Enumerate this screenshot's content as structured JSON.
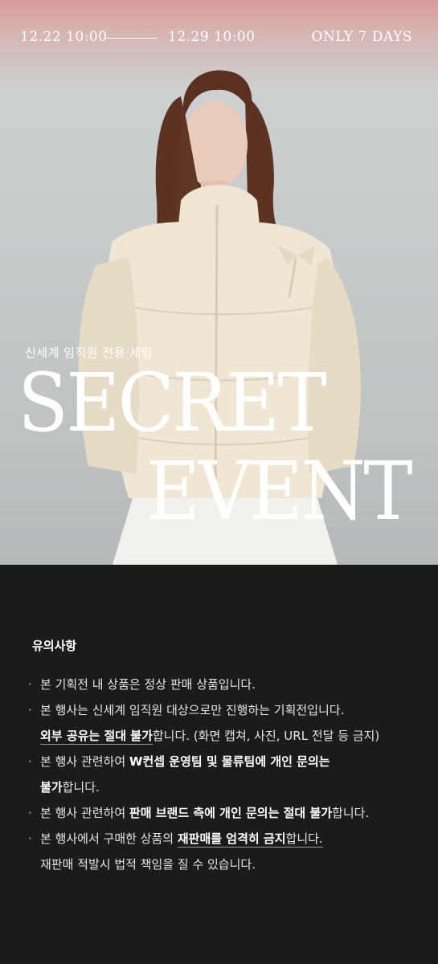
{
  "header": {
    "date_start": "12.22 10:00",
    "date_end": "12.29 10:00",
    "duration": "ONLY 7 DAYS"
  },
  "hero": {
    "subtitle": "신세계 임직원 전용 세일",
    "title_line1": "SECRET",
    "title_line2": "EVENT",
    "image_desc": "model-in-cream-padded-jacket"
  },
  "notice": {
    "title": "유의사항",
    "items": [
      {
        "text": "본 기획전 내 상품은 정상 판매 상품입니다."
      },
      {
        "text_a": "본 행사는 신세계 임직원 대상으로만 진행하는 기획전입니다.",
        "text_b_bold": "외부 공유는 절대 불가",
        "text_b": "합니다. (화면 캡쳐, 사진, URL 전달 등 금지)"
      },
      {
        "text_a": "본 행사 관련하여 ",
        "bold_a": "W컨셉 운영팀 및 물류팀에 개인 문의는",
        "bold_b": "불가",
        "text_b": "합니다."
      },
      {
        "text_a": "본 행사 관련하여 ",
        "bold_a": "판매 브랜드 측에 개인 문의는 절대 불가",
        "text_b": "합니다."
      },
      {
        "text_a": "본 행사에서 구매한 상품의 ",
        "bold_a": "재판매를 엄격히 금지",
        "text_b": "합니다.",
        "text_c": "재판매 적발시 법적 책임을 질 수 있습니다."
      }
    ]
  },
  "colors": {
    "top_gradient": "#d9999a",
    "background_gray": "#c7cbcc",
    "notice_bg": "#1b1b1b",
    "jacket": "#efe7d3",
    "hair": "#5c3322"
  }
}
